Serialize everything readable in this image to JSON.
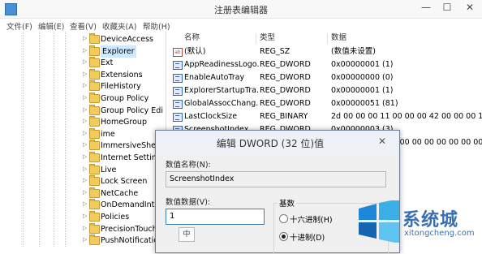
{
  "window": {
    "title": "注册表编辑器",
    "close_glyph": "✕",
    "min_glyph": "—",
    "max_glyph": "☐"
  },
  "menu": [
    "文件(F)",
    "编辑(E)",
    "查看(V)",
    "收藏夹(A)",
    "帮助(H)"
  ],
  "tree": {
    "items": [
      {
        "label": "DeviceAccess",
        "selected": false
      },
      {
        "label": "Explorer",
        "selected": true
      },
      {
        "label": "Ext",
        "selected": false
      },
      {
        "label": "Extensions",
        "selected": false
      },
      {
        "label": "FileHistory",
        "selected": false
      },
      {
        "label": "Group Policy",
        "selected": false
      },
      {
        "label": "Group Policy Edi",
        "selected": false
      },
      {
        "label": "HomeGroup",
        "selected": false
      },
      {
        "label": "ime",
        "selected": false
      },
      {
        "label": "ImmersiveShell",
        "selected": false
      },
      {
        "label": "Internet Settings",
        "selected": false
      },
      {
        "label": "Live",
        "selected": false
      },
      {
        "label": "Lock Screen",
        "selected": false
      },
      {
        "label": "NetCache",
        "selected": false
      },
      {
        "label": "OnDemandInter",
        "selected": false
      },
      {
        "label": "Policies",
        "selected": false
      },
      {
        "label": "PrecisionTouchP",
        "selected": false
      },
      {
        "label": "PushNotification",
        "selected": false
      }
    ]
  },
  "list": {
    "columns": [
      "名称",
      "类型",
      "数据"
    ],
    "rows": [
      {
        "icon": "string",
        "name": "(默认)",
        "type": "REG_SZ",
        "data": "(数值未设置)"
      },
      {
        "icon": "dword",
        "name": "AppReadinessLogo...",
        "type": "REG_DWORD",
        "data": "0x00000001 (1)"
      },
      {
        "icon": "dword",
        "name": "EnableAutoTray",
        "type": "REG_DWORD",
        "data": "0x00000000 (0)"
      },
      {
        "icon": "dword",
        "name": "ExplorerStartupTra...",
        "type": "REG_DWORD",
        "data": "0x00000001 (1)"
      },
      {
        "icon": "dword",
        "name": "GlobalAssocChang...",
        "type": "REG_DWORD",
        "data": "0x00000051 (81)"
      },
      {
        "icon": "dword",
        "name": "LastClockSize",
        "type": "REG_BINARY",
        "data": "2d 00 00 00 11 00 00 00 42 00 00 00 11 0"
      },
      {
        "icon": "dword",
        "name": "ScreenshotIndex",
        "type": "REG_DWORD",
        "data": "0x00000003 (3)"
      },
      {
        "icon": "dword",
        "name": "",
        "type": "",
        "data": "3 00 00 00 00 00 00 00 00 00 00 00 00"
      }
    ]
  },
  "dialog": {
    "title": "编辑 DWORD (32 位)值",
    "name_label": "数值名称(N):",
    "name_value": "ScreenshotIndex",
    "data_label": "数值数据(V):",
    "data_value": "1",
    "ime_char": "中",
    "base_label": "基数",
    "radio_hex": "十六进制(H)",
    "radio_dec": "十进制(D)",
    "selected_base": "dec"
  },
  "watermark": {
    "text": "系统城",
    "url": "xitongcheng.com",
    "colors": [
      "#1e88d8",
      "#3bb0e8",
      "#1565b0",
      "#5ec3f0"
    ]
  }
}
